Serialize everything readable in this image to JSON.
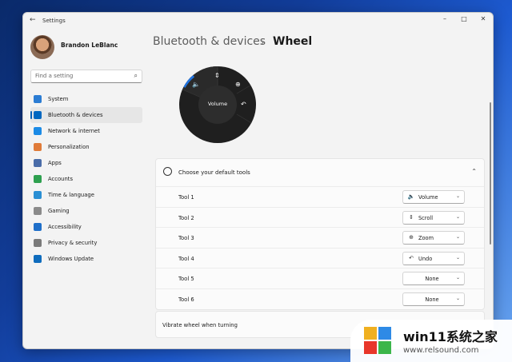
{
  "window": {
    "title": "Settings",
    "controls": [
      "–",
      "□",
      "✕"
    ]
  },
  "user": {
    "name": "Brandon LeBlanc"
  },
  "search": {
    "placeholder": "Find a setting"
  },
  "sidebar": {
    "items": [
      {
        "label": "System",
        "icon": "system-icon",
        "color": "#2b7cd3"
      },
      {
        "label": "Bluetooth & devices",
        "icon": "bluetooth-icon",
        "color": "#0067c0",
        "active": true
      },
      {
        "label": "Network & internet",
        "icon": "wifi-icon",
        "color": "#1c8be6"
      },
      {
        "label": "Personalization",
        "icon": "brush-icon",
        "color": "#e07b39"
      },
      {
        "label": "Apps",
        "icon": "apps-icon",
        "color": "#4a6ca8"
      },
      {
        "label": "Accounts",
        "icon": "person-icon",
        "color": "#2ea04f"
      },
      {
        "label": "Time & language",
        "icon": "globe-icon",
        "color": "#2a8fd4"
      },
      {
        "label": "Gaming",
        "icon": "gaming-icon",
        "color": "#8a8a8a"
      },
      {
        "label": "Accessibility",
        "icon": "accessibility-icon",
        "color": "#1f6fc9"
      },
      {
        "label": "Privacy & security",
        "icon": "shield-icon",
        "color": "#7a7a7a"
      },
      {
        "label": "Windows Update",
        "icon": "update-icon",
        "color": "#0f6cbd"
      }
    ]
  },
  "breadcrumb": {
    "parent": "Bluetooth & devices",
    "separator": "›",
    "current": "Wheel"
  },
  "wheel": {
    "center_label": "Volume"
  },
  "tools": {
    "header": "Choose your default tools",
    "rows": [
      {
        "name": "Tool 1",
        "value": "Volume",
        "icon": "volume-icon",
        "glyph": "🔈"
      },
      {
        "name": "Tool 2",
        "value": "Scroll",
        "icon": "scroll-icon",
        "glyph": "⇕"
      },
      {
        "name": "Tool 3",
        "value": "Zoom",
        "icon": "zoom-icon",
        "glyph": "⊕"
      },
      {
        "name": "Tool 4",
        "value": "Undo",
        "icon": "undo-icon",
        "glyph": "↶"
      },
      {
        "name": "Tool 5",
        "value": "None",
        "icon": "",
        "glyph": ""
      },
      {
        "name": "Tool 6",
        "value": "None",
        "icon": "",
        "glyph": ""
      }
    ]
  },
  "vibrate": {
    "label": "Vibrate wheel when turning"
  },
  "watermark": {
    "title": "win11系统之家",
    "url": "www.relsound.com"
  },
  "colors": {
    "accent": "#005fb8",
    "wheel": "#1f1f1f",
    "wheel_active": "#1f73e0"
  }
}
